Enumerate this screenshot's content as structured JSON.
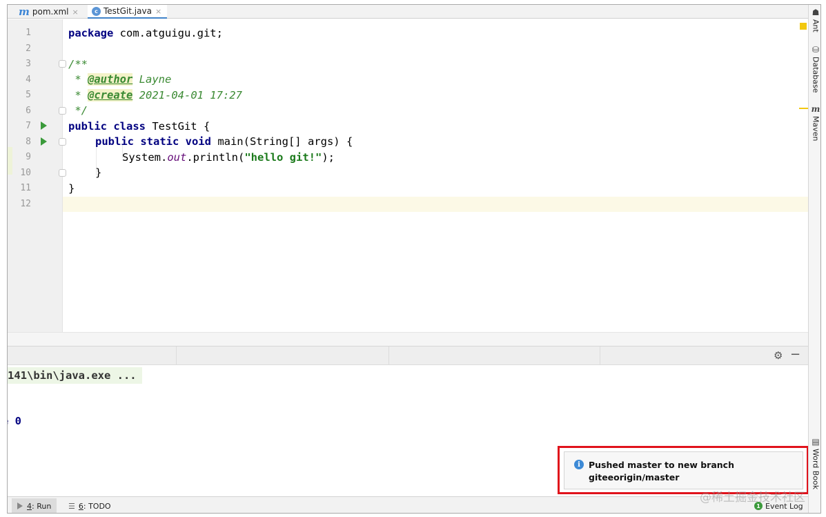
{
  "tabs": [
    {
      "icon": "m",
      "label": "pom.xml",
      "close": "×"
    },
    {
      "icon": "c",
      "label": "TestGit.java",
      "close": "×"
    }
  ],
  "editor": {
    "line_numbers": [
      "1",
      "2",
      "3",
      "4",
      "5",
      "6",
      "7",
      "8",
      "9",
      "10",
      "11",
      "12"
    ],
    "lines": {
      "l1_kw": "package",
      "l1_rest": " com.atguigu.git;",
      "l3": "/**",
      "l4_pre": " * ",
      "l4_tag": "@author",
      "l4_val": " Layne",
      "l5_pre": " * ",
      "l5_tag": "@create",
      "l5_val": " 2021-04-01 17:27",
      "l6": " */",
      "l7_kw": "public class",
      "l7_rest": " TestGit {",
      "l8_kw": "public static void",
      "l8_rest": " main(String[] args) {",
      "l9_a": "System.",
      "l9_field": "out",
      "l9_b": ".println(",
      "l9_str": "\"hello git!\"",
      "l9_c": ");",
      "l10": "}",
      "l11": "}"
    }
  },
  "right_tools": [
    {
      "icon": "ant-icon",
      "label": "Ant"
    },
    {
      "icon": "database-icon",
      "label": "Database"
    },
    {
      "icon": "maven-icon",
      "label": "Maven"
    },
    {
      "icon": "word-book-icon",
      "label": "Word Book"
    }
  ],
  "console": {
    "line1": "141\\bin\\java.exe ...",
    "line2": "e 0"
  },
  "notification": {
    "line1": "Pushed master to new branch",
    "line2": "giteeorigin/master"
  },
  "statusbar": {
    "run_num": "4",
    "run_label": ": Run",
    "todo_num": "6",
    "todo_label": ": TODO",
    "event_log": "Event Log"
  },
  "watermark": "@稀土掘金技术社区",
  "colors": {
    "accent": "#4083c9",
    "highlight_border": "#e0121b",
    "run_green": "#3a9a3a"
  }
}
